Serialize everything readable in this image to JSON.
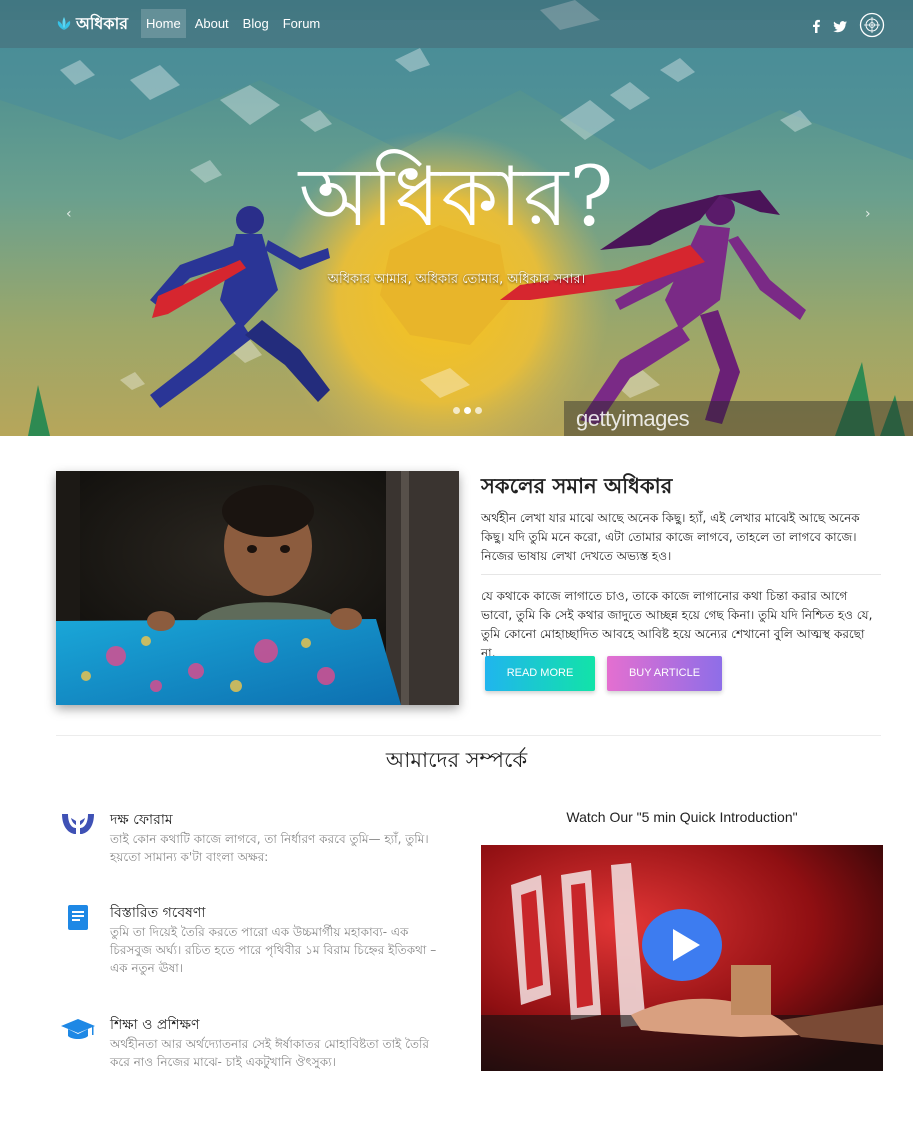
{
  "nav": {
    "brand": "অধিকার",
    "links": [
      "Home",
      "About",
      "Blog",
      "Forum"
    ],
    "social_icons": [
      "facebook-icon",
      "twitter-icon",
      "un-emblem-icon"
    ]
  },
  "hero": {
    "title": "অধিকার?",
    "subtitle": "অধিকার আমার, অধিকার তোমার, অধিকার সবার।",
    "watermark": "gettyimages",
    "prev_icon": "‹",
    "next_icon": "›",
    "slides": 3,
    "active_slide": 2
  },
  "article": {
    "title": "সকলের সমান অধিকার",
    "para1": "অর্থহীন লেখা যার মাঝে আছে অনেক কিছু। হ্যাঁ, এই লেখার মাঝেই আছে অনেক কিছু। যদি তুমি মনে করো, এটা তোমার কাজে লাগবে, তাহলে তা লাগবে কাজে। নিজের ভাষায় লেখা দেখতে অভ্যস্ত হও।",
    "para2": "যে কথাকে কাজে লাগাতে চাও, তাকে কাজে লাগানোর কথা চিন্তা করার আগে ভাবো, তুমি কি সেই কথার জাদুতে আচ্ছন্ন হয়ে গেছ কিনা। তুমি যদি নিশ্চিত হও যে, তুমি কোনো মোহাচ্ছাদিত আবহে আবিষ্ট হয়ে অন্যের শেখানো বুলি আত্মস্থ করছো না,",
    "read_more": "READ MORE",
    "buy": "BUY ARTICLE"
  },
  "about": {
    "title": "আমাদের সম্পর্কে",
    "features": [
      {
        "icon": "hands-icon",
        "title": "দক্ষ ফোরাম",
        "desc": "তাই কোন কথাটি কাজে লাগবে, তা নির্ধারণ করবে তুমি— হ্যাঁ, তুমি। হয়তো সামান্য ক'টা বাংলা অক্ষর:"
      },
      {
        "icon": "book-icon",
        "title": "বিস্তারিত গবেষণা",
        "desc": "তুমি তা দিয়েই তৈরি করতে পারো এক উচ্চমার্গীয় মহাকাব্য- এক চিরসবুজ অর্ঘ্য। রচিত হতে পারে পৃথিবীর ১ম বিরাম চিহ্নের ইতিকথা – এক নতুন ঊষা।"
      },
      {
        "icon": "graduation-cap-icon",
        "title": "শিক্ষা ও প্রশিক্ষণ",
        "desc": "অর্থহীনতা আর অর্থদ্যোতনার সেই ঈর্ষাকাতর মোহাবিষ্টতা তাই তৈরি করে নাও নিজের মাঝে- চাই একটুখানি ঔৎসুক্য।"
      }
    ],
    "video_title": "Watch Our \"5 min Quick Introduction\""
  },
  "colors": {
    "accent_blue": "#3d7cf0",
    "read_more_gradient": [
      "#20b5ee",
      "#12e3a8"
    ],
    "buy_gradient": [
      "#e46fd0",
      "#8e6ee8"
    ],
    "icon_blue": "#3f51b5"
  }
}
